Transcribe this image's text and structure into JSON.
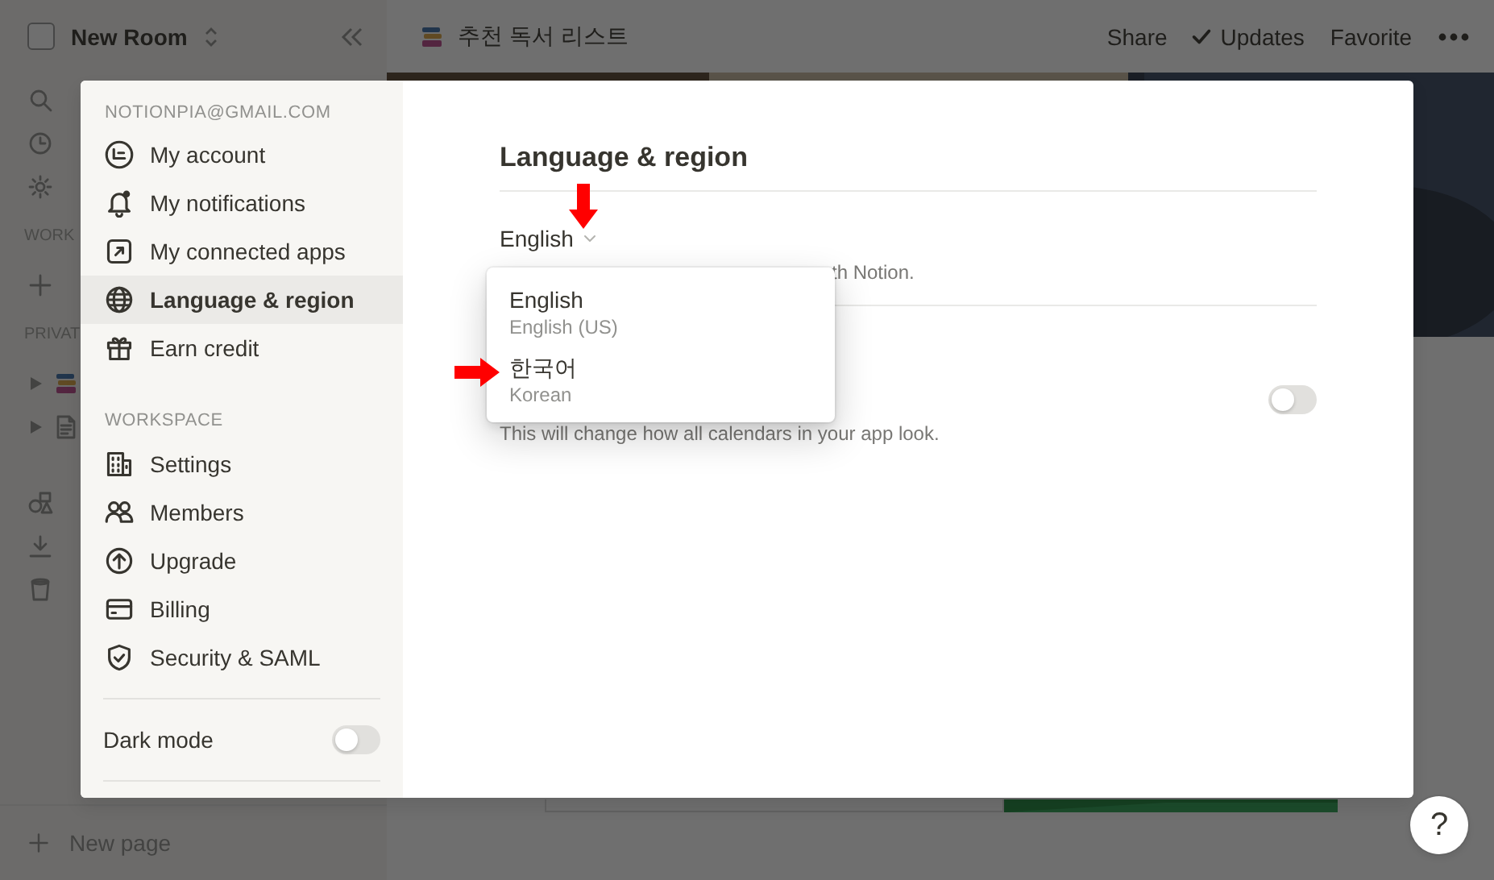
{
  "sidebar": {
    "workspace_name": "New Room",
    "items": [
      {
        "kind": "search"
      },
      {
        "kind": "clock"
      },
      {
        "kind": "gear"
      },
      {
        "kind": "heading",
        "label": "WORK"
      },
      {
        "kind": "plus"
      },
      {
        "kind": "heading",
        "label": "PRIVAT"
      },
      {
        "kind": "page-book"
      },
      {
        "kind": "page-doc"
      },
      {
        "kind": "gap"
      },
      {
        "kind": "shapes"
      },
      {
        "kind": "download"
      },
      {
        "kind": "trash"
      }
    ],
    "new_page": "New page"
  },
  "topbar": {
    "page_title": "추천 독서 리스트",
    "actions": [
      {
        "kind": "text",
        "label": "Share"
      },
      {
        "kind": "check",
        "label": "Updates"
      },
      {
        "kind": "text",
        "label": "Favorite"
      },
      {
        "kind": "more"
      }
    ]
  },
  "settings": {
    "account_email": "NOTIONPIA@GMAIL.COM",
    "account_items": [
      {
        "label": "My account",
        "selected": false
      },
      {
        "label": "My notifications",
        "selected": false
      },
      {
        "label": "My connected apps",
        "selected": false
      },
      {
        "label": "Language & region",
        "selected": true
      },
      {
        "label": "Earn credit",
        "selected": false
      }
    ],
    "workspace_heading": "WORKSPACE",
    "workspace_items": [
      {
        "label": "Settings",
        "selected": false
      },
      {
        "label": "Members",
        "selected": false
      },
      {
        "label": "Upgrade",
        "selected": false
      },
      {
        "label": "Billing",
        "selected": false
      },
      {
        "label": "Security & SAML",
        "selected": false
      }
    ],
    "dark_mode": {
      "label": "Dark mode",
      "on": false
    },
    "page_title": "Language & region",
    "language_select": {
      "value": "English"
    },
    "language_description": "th Notion.",
    "calendar_toggle": {
      "on": false
    },
    "calendar_description": "This will change how all calendars in your app look.",
    "language_options": [
      {
        "label": "English",
        "sublabel": "English (US)"
      },
      {
        "label": "한국어",
        "sublabel": "Korean"
      }
    ]
  },
  "help_button": "?"
}
